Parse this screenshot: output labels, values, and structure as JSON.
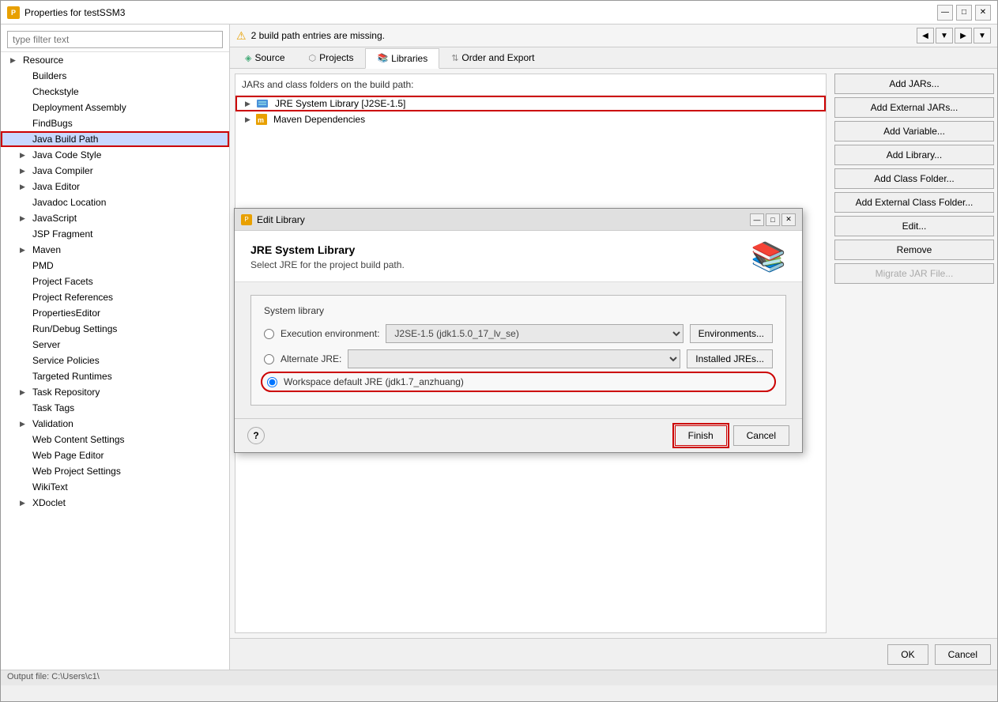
{
  "window": {
    "title": "Properties for testSSM3",
    "minimize": "—",
    "maximize": "□",
    "close": "✕"
  },
  "filter": {
    "placeholder": "type filter text"
  },
  "sidebar": {
    "items": [
      {
        "label": "Resource",
        "expandable": true,
        "indent": 0
      },
      {
        "label": "Builders",
        "expandable": false,
        "indent": 1
      },
      {
        "label": "Checkstyle",
        "expandable": false,
        "indent": 1
      },
      {
        "label": "Deployment Assembly",
        "expandable": false,
        "indent": 1
      },
      {
        "label": "FindBugs",
        "expandable": false,
        "indent": 1
      },
      {
        "label": "Java Build Path",
        "expandable": false,
        "indent": 1,
        "selected": true
      },
      {
        "label": "Java Code Style",
        "expandable": true,
        "indent": 1
      },
      {
        "label": "Java Compiler",
        "expandable": true,
        "indent": 1
      },
      {
        "label": "Java Editor",
        "expandable": true,
        "indent": 1
      },
      {
        "label": "Javadoc Location",
        "expandable": false,
        "indent": 1
      },
      {
        "label": "JavaScript",
        "expandable": true,
        "indent": 1
      },
      {
        "label": "JSP Fragment",
        "expandable": false,
        "indent": 1
      },
      {
        "label": "Maven",
        "expandable": true,
        "indent": 1
      },
      {
        "label": "PMD",
        "expandable": false,
        "indent": 1
      },
      {
        "label": "Project Facets",
        "expandable": false,
        "indent": 1
      },
      {
        "label": "Project References",
        "expandable": false,
        "indent": 1
      },
      {
        "label": "PropertiesEditor",
        "expandable": false,
        "indent": 1
      },
      {
        "label": "Run/Debug Settings",
        "expandable": false,
        "indent": 1
      },
      {
        "label": "Server",
        "expandable": false,
        "indent": 1
      },
      {
        "label": "Service Policies",
        "expandable": false,
        "indent": 1
      },
      {
        "label": "Targeted Runtimes",
        "expandable": false,
        "indent": 1
      },
      {
        "label": "Task Repository",
        "expandable": true,
        "indent": 1
      },
      {
        "label": "Task Tags",
        "expandable": false,
        "indent": 1
      },
      {
        "label": "Validation",
        "expandable": true,
        "indent": 1
      },
      {
        "label": "Web Content Settings",
        "expandable": false,
        "indent": 1
      },
      {
        "label": "Web Page Editor",
        "expandable": false,
        "indent": 1
      },
      {
        "label": "Web Project Settings",
        "expandable": false,
        "indent": 1
      },
      {
        "label": "WikiText",
        "expandable": false,
        "indent": 1
      },
      {
        "label": "XDoclet",
        "expandable": true,
        "indent": 1
      }
    ]
  },
  "warning": {
    "message": "2 build path entries are missing."
  },
  "tabs": [
    {
      "label": "Source",
      "icon": "source"
    },
    {
      "label": "Projects",
      "icon": "projects"
    },
    {
      "label": "Libraries",
      "icon": "libraries",
      "active": true
    },
    {
      "label": "Order and Export",
      "icon": "order"
    }
  ],
  "buildpath": {
    "label": "JARs and class folders on the build path:",
    "items": [
      {
        "label": "JRE System Library [J2SE-1.5]",
        "type": "jre",
        "expandable": true,
        "highlighted": true
      },
      {
        "label": "Maven Dependencies",
        "type": "jar",
        "expandable": true
      }
    ]
  },
  "buttons": {
    "addJars": "Add JARs...",
    "addExternalJars": "Add External JARs...",
    "addVariable": "Add Variable...",
    "addLibrary": "Add Library...",
    "addClassFolder": "Add Class Folder...",
    "addExternalClassFolder": "Add External Class Folder...",
    "edit": "Edit...",
    "remove": "Remove",
    "migrateJar": "Migrate JAR File..."
  },
  "bottomButtons": {
    "ok": "OK",
    "cancel": "Cancel"
  },
  "statusBar": {
    "text": "Output file: C:\\Users\\c1\\"
  },
  "dialog": {
    "title": "Edit Library",
    "heading": "JRE System Library",
    "description": "Select JRE for the project build path.",
    "groupLabel": "System library",
    "executionEnvLabel": "Execution environment:",
    "executionEnvValue": "J2SE-1.5 (jdk1.5.0_17_lv_se)",
    "environmentsBtn": "Environments...",
    "alternateJreLabel": "Alternate JRE:",
    "alternateJreValue": "",
    "installedJresBtn": "Installed JREs...",
    "workspaceLabel": "Workspace default JRE (jdk1.7_anzhuang)",
    "finishBtn": "Finish",
    "cancelBtn": "Cancel"
  }
}
